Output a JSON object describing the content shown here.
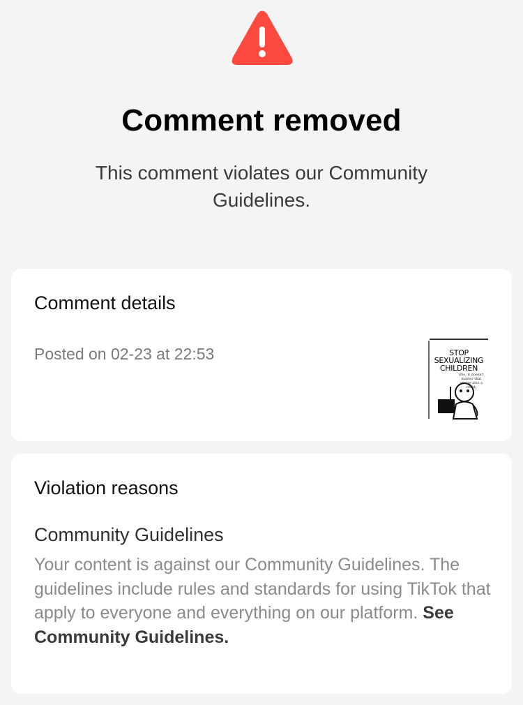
{
  "header": {
    "icon": "warning-triangle-icon",
    "icon_color": "#FE4A3E",
    "title": "Comment removed",
    "subtitle": "This comment violates our Community Guidelines."
  },
  "details_card": {
    "title": "Comment details",
    "posted": "Posted on 02-23 at 22:53",
    "thumbnail": {
      "text_line1": "STOP",
      "text_line2": "SEXUALIZING",
      "text_line3": "CHILDREN",
      "small_text": "(No, it doesn't matter that you're also a child)"
    }
  },
  "violation_card": {
    "title": "Violation reasons",
    "reason_heading": "Community Guidelines",
    "reason_body": "Your content is against our Community Guidelines. The guidelines include rules and standards for using TikTok that apply to everyone and everything on our platform.",
    "link_label": "See Community Guidelines."
  }
}
